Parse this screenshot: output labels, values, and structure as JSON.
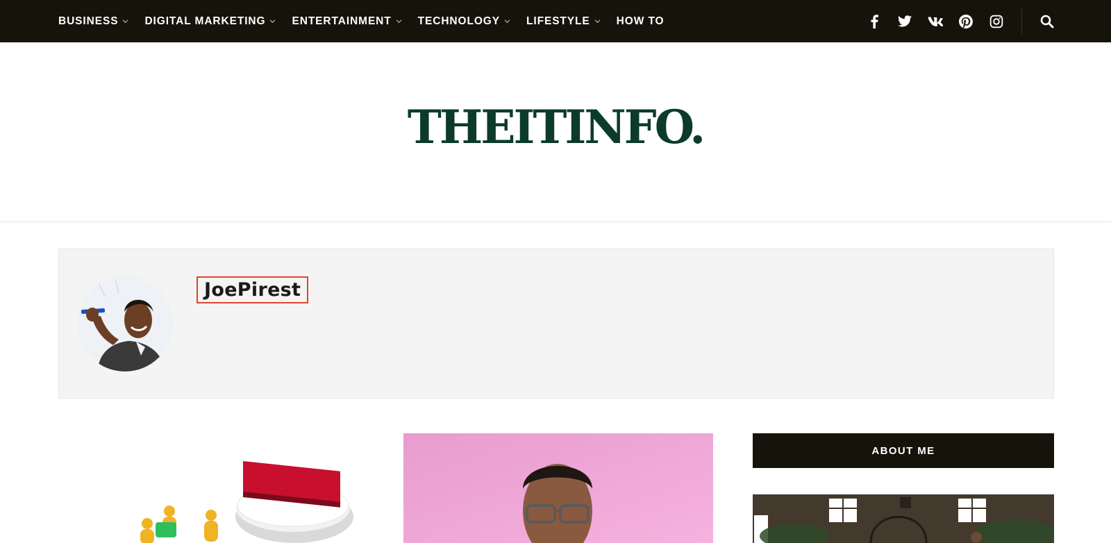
{
  "nav": {
    "items": [
      {
        "label": "BUSINESS",
        "dropdown": true
      },
      {
        "label": "DIGITAL MARKETING",
        "dropdown": true
      },
      {
        "label": "ENTERTAINMENT",
        "dropdown": true
      },
      {
        "label": "TECHNOLOGY",
        "dropdown": true
      },
      {
        "label": "LIFESTYLE",
        "dropdown": true
      },
      {
        "label": "HOW TO",
        "dropdown": false
      }
    ],
    "social_icons": [
      "facebook-icon",
      "twitter-icon",
      "vk-icon",
      "pinterest-icon",
      "instagram-icon"
    ],
    "search_icon": "search-icon"
  },
  "site": {
    "logo": "THEITINFO."
  },
  "author": {
    "name": "JoePirest"
  },
  "cards": [
    {
      "image": "trust-illustration"
    },
    {
      "image": "man-with-glasses-portrait"
    }
  ],
  "sidebar": {
    "about_label": "ABOUT ME",
    "image": "brick-house-photo"
  },
  "colors": {
    "topbar": "#15130a",
    "logo": "#0c3b2c",
    "highlight_border": "#e0452f",
    "author_box_bg": "#f4f4f4"
  }
}
